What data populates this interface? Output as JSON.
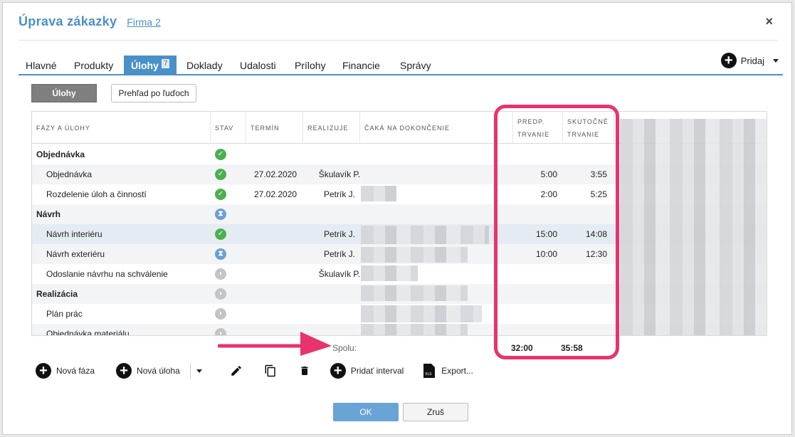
{
  "dialog": {
    "title": "Úprava zákazky",
    "company_link": "Firma 2",
    "close_glyph": "×"
  },
  "tabs": [
    {
      "label": "Hlavné"
    },
    {
      "label": "Produkty"
    },
    {
      "label": "Úlohy",
      "badge": "7",
      "active": true
    },
    {
      "label": "Doklady"
    },
    {
      "label": "Udalosti"
    },
    {
      "label": "Prílohy"
    },
    {
      "label": "Financie"
    },
    {
      "label": "Správy"
    }
  ],
  "add_menu": {
    "label": "Pridaj"
  },
  "view_toggle": {
    "tasks": "Úlohy",
    "by_people": "Prehľad po ľuďoch"
  },
  "grid": {
    "headers": {
      "phases": "FÁZY A ÚLOHY",
      "status": "STAV",
      "term": "TERMÍN",
      "assignee": "REALIZUJE",
      "waiting": "ČAKÁ NA DOKONČENIE",
      "planned_1": "PREDP.",
      "planned_2": "TRVANIE",
      "actual_1": "SKUTOČNÉ",
      "actual_2": "TRVANIE"
    },
    "rows": [
      {
        "name": "Objednávka",
        "type": "phase",
        "status": "done",
        "term": "",
        "assignee": "",
        "planned": "",
        "actual": ""
      },
      {
        "name": "Objednávka",
        "type": "task",
        "status": "done",
        "term": "27.02.2020",
        "assignee": "Škulavík P.",
        "planned": "5:00",
        "actual": "3:55"
      },
      {
        "name": "Rozdelenie úloh a činností",
        "type": "task",
        "status": "done",
        "term": "27.02.2020",
        "assignee": "Petrík J.",
        "planned": "2:00",
        "actual": "5:25"
      },
      {
        "name": "Návrh",
        "type": "phase",
        "status": "progress",
        "term": "",
        "assignee": "",
        "planned": "",
        "actual": ""
      },
      {
        "name": "Návrh interiéru",
        "type": "task",
        "status": "done",
        "term": "",
        "assignee": "Petrík J.",
        "planned": "15:00",
        "actual": "14:08"
      },
      {
        "name": "Návrh exteriéru",
        "type": "task",
        "status": "progress",
        "term": "",
        "assignee": "Petrík J.",
        "planned": "10:00",
        "actual": "12:30"
      },
      {
        "name": "Odoslanie návrhu na schválenie",
        "type": "task",
        "status": "waiting",
        "term": "",
        "assignee": "Škulavík P.",
        "planned": "",
        "actual": ""
      },
      {
        "name": "Realizácia",
        "type": "phase",
        "status": "waiting",
        "term": "",
        "assignee": "",
        "planned": "",
        "actual": ""
      },
      {
        "name": "Plán prác",
        "type": "task",
        "status": "waiting",
        "term": "",
        "assignee": "",
        "planned": "",
        "actual": ""
      },
      {
        "name": "Objednávka materiálu",
        "type": "task",
        "status": "waiting",
        "term": "",
        "assignee": "",
        "planned": "",
        "actual": ""
      }
    ],
    "totals": {
      "label": "Spolu:",
      "planned": "32:00",
      "actual": "35:58"
    }
  },
  "toolbar": {
    "new_phase": "Nová fáza",
    "new_task": "Nová úloha",
    "add_interval": "Pridať interval",
    "export": "Export..."
  },
  "footer": {
    "ok": "OK",
    "cancel": "Zruš"
  },
  "colors": {
    "accent": "#4a90c8",
    "highlight": "#e8336e",
    "done": "#4caf50",
    "progress": "#6a9fd8",
    "waiting": "#c4c4c4"
  }
}
